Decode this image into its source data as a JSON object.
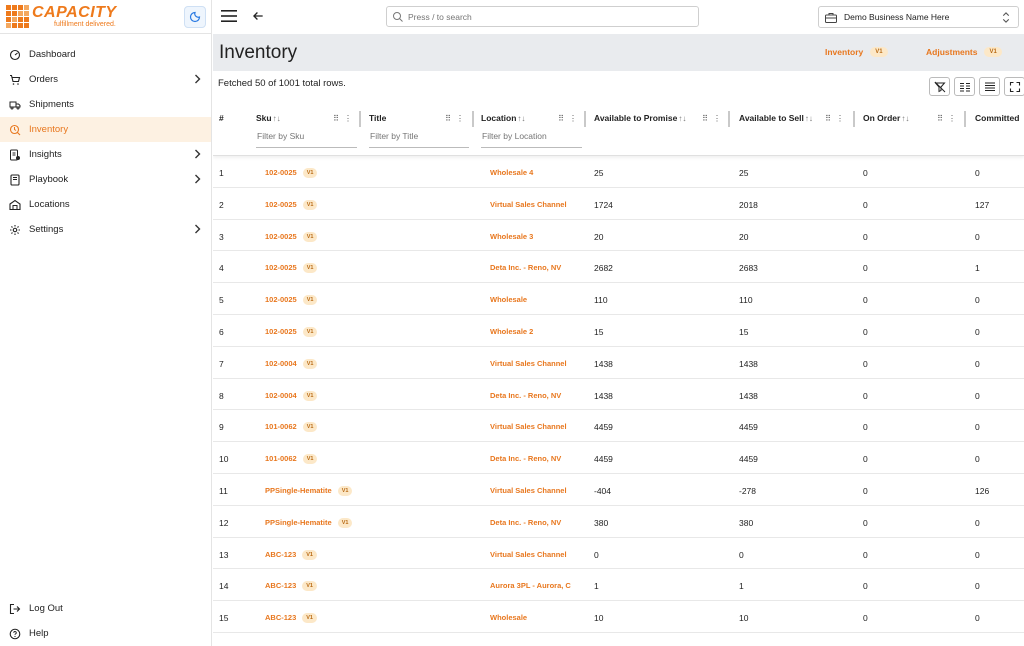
{
  "brand": {
    "name": "CAPACITY",
    "tagline": "fulfillment delivered."
  },
  "sidebar": {
    "items": [
      {
        "label": "Dashboard",
        "icon": "dashboard-icon",
        "chevron": false,
        "active": false
      },
      {
        "label": "Orders",
        "icon": "cart-icon",
        "chevron": true,
        "active": false
      },
      {
        "label": "Shipments",
        "icon": "truck-icon",
        "chevron": false,
        "active": false
      },
      {
        "label": "Inventory",
        "icon": "inventory-icon",
        "chevron": false,
        "active": true
      },
      {
        "label": "Insights",
        "icon": "insights-icon",
        "chevron": true,
        "active": false
      },
      {
        "label": "Playbook",
        "icon": "book-icon",
        "chevron": true,
        "active": false
      },
      {
        "label": "Locations",
        "icon": "warehouse-icon",
        "chevron": false,
        "active": false
      },
      {
        "label": "Settings",
        "icon": "gear-icon",
        "chevron": true,
        "active": false
      }
    ],
    "bottom": [
      {
        "label": "Log Out",
        "icon": "logout-icon"
      },
      {
        "label": "Help",
        "icon": "help-icon"
      }
    ]
  },
  "topbar": {
    "search_placeholder": "Press / to search",
    "business": "Demo Business Name Here"
  },
  "page": {
    "title": "Inventory",
    "links": [
      {
        "label": "Inventory",
        "badge": "V1"
      },
      {
        "label": "Adjustments",
        "badge": "V1"
      }
    ],
    "fetched": "Fetched 50 of 1001 total rows."
  },
  "table": {
    "columns": {
      "num": "#",
      "sku": "Sku",
      "title": "Title",
      "location": "Location",
      "atp": "Available to Promise",
      "ats": "Available to Sell",
      "on_order": "On Order",
      "committed": "Committed"
    },
    "filters": {
      "sku": "Filter by Sku",
      "title": "Filter by Title",
      "location": "Filter by Location"
    },
    "badge": "V1",
    "rows": [
      {
        "n": "1",
        "sku": "102-0025",
        "loc": "Wholesale 4",
        "atp": "25",
        "ats": "25",
        "oo": "0",
        "com": "0"
      },
      {
        "n": "2",
        "sku": "102-0025",
        "loc": "Virtual Sales Channel",
        "atp": "1724",
        "ats": "2018",
        "oo": "0",
        "com": "127"
      },
      {
        "n": "3",
        "sku": "102-0025",
        "loc": "Wholesale 3",
        "atp": "20",
        "ats": "20",
        "oo": "0",
        "com": "0"
      },
      {
        "n": "4",
        "sku": "102-0025",
        "loc": "Deta Inc. - Reno, NV",
        "atp": "2682",
        "ats": "2683",
        "oo": "0",
        "com": "1"
      },
      {
        "n": "5",
        "sku": "102-0025",
        "loc": "Wholesale",
        "atp": "110",
        "ats": "110",
        "oo": "0",
        "com": "0"
      },
      {
        "n": "6",
        "sku": "102-0025",
        "loc": "Wholesale 2",
        "atp": "15",
        "ats": "15",
        "oo": "0",
        "com": "0"
      },
      {
        "n": "7",
        "sku": "102-0004",
        "loc": "Virtual Sales Channel",
        "atp": "1438",
        "ats": "1438",
        "oo": "0",
        "com": "0"
      },
      {
        "n": "8",
        "sku": "102-0004",
        "loc": "Deta Inc. - Reno, NV",
        "atp": "1438",
        "ats": "1438",
        "oo": "0",
        "com": "0"
      },
      {
        "n": "9",
        "sku": "101-0062",
        "loc": "Virtual Sales Channel",
        "atp": "4459",
        "ats": "4459",
        "oo": "0",
        "com": "0"
      },
      {
        "n": "10",
        "sku": "101-0062",
        "loc": "Deta Inc. - Reno, NV",
        "atp": "4459",
        "ats": "4459",
        "oo": "0",
        "com": "0"
      },
      {
        "n": "11",
        "sku": "PPSingle-Hematite",
        "loc": "Virtual Sales Channel",
        "atp": "-404",
        "ats": "-278",
        "oo": "0",
        "com": "126"
      },
      {
        "n": "12",
        "sku": "PPSingle-Hematite",
        "loc": "Deta Inc. - Reno, NV",
        "atp": "380",
        "ats": "380",
        "oo": "0",
        "com": "0"
      },
      {
        "n": "13",
        "sku": "ABC-123",
        "loc": "Virtual Sales Channel",
        "atp": "0",
        "ats": "0",
        "oo": "0",
        "com": "0"
      },
      {
        "n": "14",
        "sku": "ABC-123",
        "loc": "Aurora 3PL - Aurora, C",
        "atp": "1",
        "ats": "1",
        "oo": "0",
        "com": "0"
      },
      {
        "n": "15",
        "sku": "ABC-123",
        "loc": "Wholesale",
        "atp": "10",
        "ats": "10",
        "oo": "0",
        "com": "0"
      }
    ]
  },
  "colors": {
    "accent": "#e8771e",
    "active_bg": "#fdf1e2",
    "header_bg": "#e9ebee"
  }
}
